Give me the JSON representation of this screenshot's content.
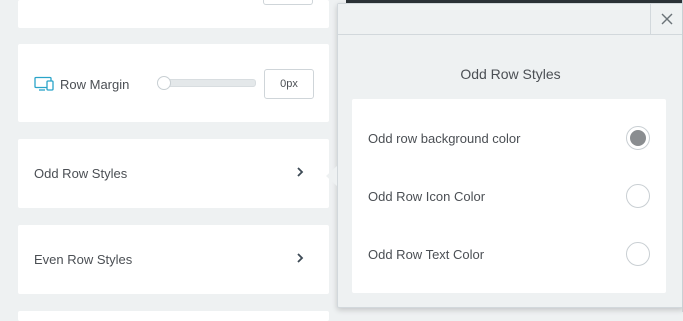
{
  "left_panel": {
    "row_margin": {
      "label": "Row Margin",
      "value": "0px",
      "slider_level": 0,
      "icon": "desktop-icon"
    },
    "odd_row_styles": {
      "label": "Odd Row Styles",
      "icon": "chevron-right-icon"
    },
    "even_row_styles": {
      "label": "Even Row Styles",
      "icon": "chevron-right-icon"
    }
  },
  "popover": {
    "title": "Odd Row Styles",
    "close_icon": "close-icon",
    "options": [
      {
        "label": "Odd row background color",
        "color": "#8a8d90",
        "filled": true
      },
      {
        "label": "Odd Row Icon Color",
        "color": "#ffffff",
        "filled": false
      },
      {
        "label": "Odd Row Text Color",
        "color": "#ffffff",
        "filled": false
      }
    ]
  },
  "colors": {
    "panel_bg": "#eef1f2",
    "card_bg": "#ffffff",
    "accent_icon": "#2aa4c9",
    "text": "#4b4f54"
  }
}
